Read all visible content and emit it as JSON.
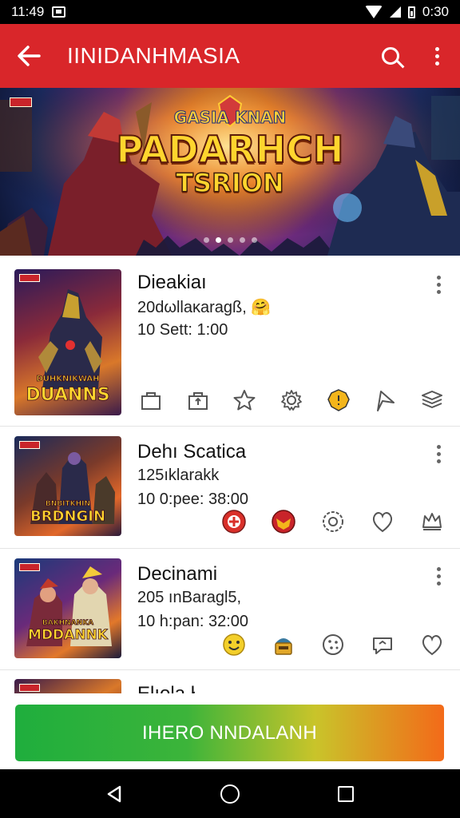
{
  "status_bar": {
    "time_left": "11:49",
    "time_right": "0:30"
  },
  "app_bar": {
    "title": "IINIDANHMASIA"
  },
  "banner": {
    "title_top": "GASIA KNAN",
    "title_main": "PADARHCH",
    "title_sub": "TSRION",
    "slide_count": 5,
    "active_slide": 2
  },
  "items": [
    {
      "title": "Dieakiaı",
      "line1": "20dωllaκaragß, 🤗",
      "line2": "10 Sett: 1:00",
      "thumb_label_small": "DUHKNIKWAH",
      "thumb_label": "DUANNS",
      "actions": [
        "bag-icon",
        "share-bag-icon",
        "star-icon",
        "gear-icon",
        "badge-icon",
        "flag-icon",
        "stack-icon"
      ]
    },
    {
      "title": "Dehı Scatica",
      "line1": "125ıklarakk",
      "line2": "10 0:pee: 38:00",
      "thumb_label_small": "BNBITKHIN",
      "thumb_label": "BRDNGIN",
      "actions": [
        "red-emblem-icon",
        "mask-icon",
        "medal-icon",
        "heart-icon",
        "crown-icon"
      ]
    },
    {
      "title": "Decinami",
      "line1": "205 ınBaragl5,",
      "line2": "10 h:pan: 32:00",
      "thumb_label_small": "BAKHNANKA",
      "thumb_label": "MDDANNK",
      "actions": [
        "smile-icon",
        "helmet-icon",
        "cookie-icon",
        "chat-icon",
        "heart-icon"
      ]
    },
    {
      "title": "Elıola ł"
    }
  ],
  "cta": {
    "label": "IHERO NNDALANH"
  },
  "colors": {
    "app_bar": "#d9262a",
    "cta_start": "#1fae3d",
    "cta_end": "#f36a19"
  }
}
